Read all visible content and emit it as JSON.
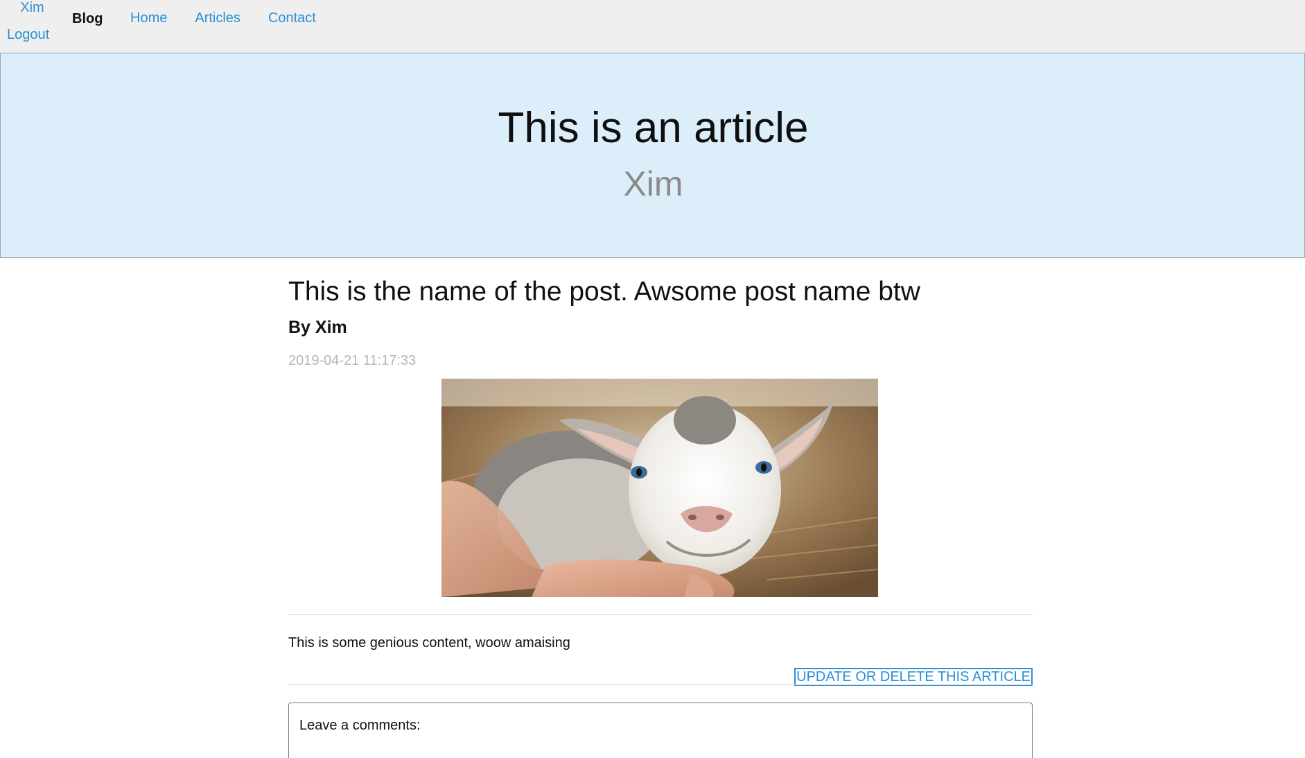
{
  "nav": {
    "user": "Xim",
    "logout": "Logout",
    "brand": "Blog",
    "links": [
      "Home",
      "Articles",
      "Contact"
    ]
  },
  "hero": {
    "title": "This is an article",
    "subtitle": "Xim"
  },
  "post": {
    "title": "This is the name of the post. Awsome post name btw",
    "byline": "By Xim",
    "timestamp": "2019-04-21 11:17:33",
    "body": "This is some genious content, woow amaising",
    "update_link": "UPDATE OR DELETE THIS ARTICLE"
  },
  "comments": {
    "label": "Leave a comments:"
  },
  "colors": {
    "link": "#2a8fd3",
    "nav_bg": "#efefef",
    "hero_bg": "#ddeefb",
    "muted": "#8a8a8a"
  }
}
